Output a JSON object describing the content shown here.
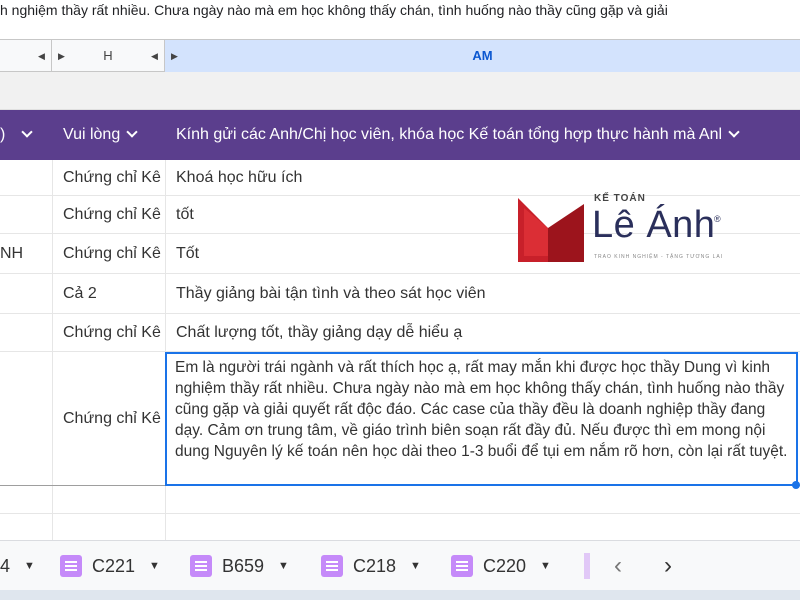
{
  "formula_bar": {
    "text": "h nghiệm thầy rất nhiều. Chưa ngày nào mà em học không thấy chán, tình huống nào thầy cũng gặp và giải"
  },
  "columns": [
    {
      "label": "",
      "selected": false
    },
    {
      "label": "H",
      "selected": false
    },
    {
      "label": "AM",
      "selected": true
    }
  ],
  "header": {
    "col1": ")",
    "col2": "Vui lòng",
    "col3": "Kính gửi các Anh/Chị học viên, khóa học Kế toán tổng hợp thực hành mà Anl"
  },
  "rows": [
    {
      "c1": "",
      "c2": "Chứng chỉ Kê",
      "c3": "Khoá học hữu ích"
    },
    {
      "c1": "",
      "c2": "Chứng chỉ Kê",
      "c3": "tốt"
    },
    {
      "c1": "NH",
      "c2": "Chứng chỉ Kê",
      "c3": "Tốt"
    },
    {
      "c1": "",
      "c2": "Cả 2",
      "c3": "Thầy giảng bài tận tình và theo sát học viên"
    },
    {
      "c1": "",
      "c2": "Chứng chỉ Kê",
      "c3": "Chất lượng tốt, thầy giảng dạy dễ hiểu ạ"
    },
    {
      "c1": "",
      "c2": "Chứng chỉ Kê",
      "c3": ""
    }
  ],
  "selected_cell_text": "Em là người trái ngành và rất thích học ạ, rất may mắn khi được học thầy Dung vì kinh nghiệm thầy rất nhiều. Chưa ngày nào mà em học không thấy chán, tình huống nào thầy cũng gặp và giải quyết rất độc đáo. Các case của thầy đều là doanh nghiệp thầy đang dạy. Cảm ơn trung tâm, về giáo trình biên soạn rất đầy đủ. Nếu được thì em mong nội dung Nguyên lý kế toán nên học dài theo 1-3 buổi để tụi em nắm rõ hơn, còn lại rất tuyệt.",
  "logo": {
    "small": "KẾ TOÁN",
    "main": "Lê Ánh",
    "reg": "®",
    "tagline": "TRAO KINH NGHIỆM - TẶNG TƯƠNG LAI",
    "accent": "#c8202a"
  },
  "sheet_tabs": [
    {
      "label": "4",
      "icon": false
    },
    {
      "label": "C221",
      "icon": true
    },
    {
      "label": "B659",
      "icon": true
    },
    {
      "label": "C218",
      "icon": true
    },
    {
      "label": "C220",
      "icon": true
    }
  ],
  "nav": {
    "prev": "‹",
    "next": "›"
  },
  "colors": {
    "header_bg": "#5b3e8d",
    "selection": "#1a73e8",
    "tab_icon": "#c58af9"
  }
}
